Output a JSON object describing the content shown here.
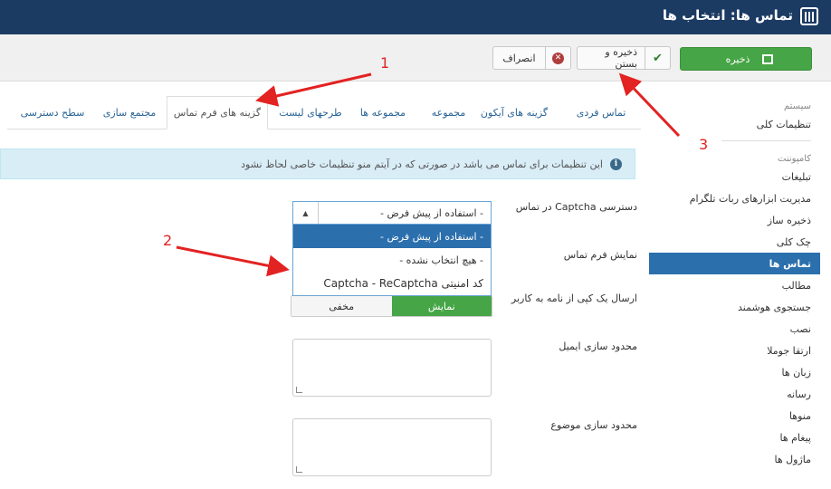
{
  "header": {
    "title": "تماس ها: انتخاب ها",
    "logo_icon": "sliders-icon"
  },
  "toolbar": {
    "save_label": "ذخیره",
    "save_close_label": "ذخیره و بستن",
    "cancel_label": "انصراف"
  },
  "sidebar": {
    "system_heading": "سیستم",
    "global_config": "تنظیمات کلی",
    "components_heading": "کامپوننت",
    "items": [
      {
        "label": "تبلیغات",
        "active": false
      },
      {
        "label": "مدیریت ابزارهای ربات تلگرام",
        "active": false
      },
      {
        "label": "ذخیره ساز",
        "active": false
      },
      {
        "label": "چک کلی",
        "active": false
      },
      {
        "label": "تماس ها",
        "active": true
      },
      {
        "label": "مطالب",
        "active": false
      },
      {
        "label": "جستجوی هوشمند",
        "active": false
      },
      {
        "label": "نصب",
        "active": false
      },
      {
        "label": "ارتقا جوملا",
        "active": false
      },
      {
        "label": "زبان ها",
        "active": false
      },
      {
        "label": "رسانه",
        "active": false
      },
      {
        "label": "منوها",
        "active": false
      },
      {
        "label": "پیغام ها",
        "active": false
      },
      {
        "label": "ماژول ها",
        "active": false
      }
    ]
  },
  "tabs": [
    {
      "label": "تماس فردی",
      "active": false
    },
    {
      "label": "گزینه های آیکون",
      "active": false
    },
    {
      "label": "مجموعه",
      "active": false
    },
    {
      "label": "مجموعه ها",
      "active": false
    },
    {
      "label": "طرحهای لیست",
      "active": false
    },
    {
      "label": "گزینه های فرم تماس",
      "active": true
    },
    {
      "label": "مجتمع سازی",
      "active": false
    },
    {
      "label": "سطح دسترسی",
      "active": false
    }
  ],
  "alert": {
    "text": "این تنظیمات برای تماس می باشد در صورتی که در آیتم منو تنظیمات خاصی لحاظ نشود",
    "icon": "info-icon"
  },
  "form": {
    "captcha_label": "دسترسی Captcha در تماس",
    "captcha_value": "- استفاده از پیش فرض -",
    "captcha_options": [
      {
        "label": "- استفاده از پیش فرض -",
        "selected": true
      },
      {
        "label": "- هیچ انتخاب نشده -",
        "selected": false
      },
      {
        "label": "کد امنیتی Captcha - ReCaptcha",
        "selected": false
      }
    ],
    "show_form_label": "نمایش فرم تماس",
    "send_copy_label": "ارسال یک کپی از نامه به کاربر",
    "toggle_show": "نمایش",
    "toggle_hide": "مخفی",
    "toggle_value": "نمایش",
    "email_limit_label": "محدود سازی ایمیل",
    "subject_limit_label": "محدود سازی موضوع"
  },
  "annotations": [
    "1",
    "2",
    "3"
  ],
  "colors": {
    "header_bg": "#1c3b63",
    "accent": "#2c6fad",
    "save_green": "#46a546",
    "annotation_red": "#e32222"
  }
}
